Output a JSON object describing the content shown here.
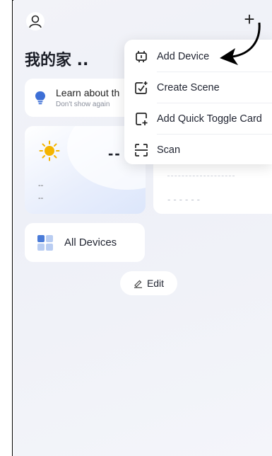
{
  "header": {
    "home_title": "我的家 ..",
    "add_symbol": "+"
  },
  "tip": {
    "title": "Learn about th",
    "subtitle": "Don't show again"
  },
  "weather": {
    "temperature": "--",
    "line1": "--",
    "line2": "--"
  },
  "energy": {
    "placeholder": "------"
  },
  "all_devices": {
    "label": "All Devices"
  },
  "edit": {
    "label": "Edit"
  },
  "menu": {
    "items": [
      {
        "label": "Add Device",
        "icon": "add-device-icon"
      },
      {
        "label": "Create Scene",
        "icon": "create-scene-icon"
      },
      {
        "label": "Add Quick Toggle Card",
        "icon": "add-card-icon"
      },
      {
        "label": "Scan",
        "icon": "scan-icon"
      }
    ]
  },
  "colors": {
    "accent": "#4a7bd8",
    "bulb": "#3d6fd6",
    "sun": "#f4b400"
  }
}
